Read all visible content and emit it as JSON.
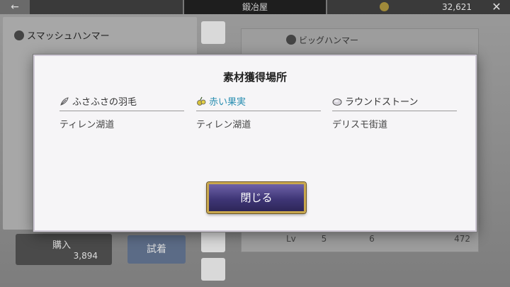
{
  "header": {
    "back_icon": "back-arrow-icon",
    "title": "鍛冶屋",
    "coin_icon": "coin-icon",
    "coins": "32,621",
    "close_icon": "close-icon"
  },
  "background": {
    "left_item_name": "スマッシュハンマー",
    "right_item_name": "ビッグハンマー",
    "lv_label": "Lv",
    "lv_value": "5",
    "stat_value": "6",
    "right_price": "472",
    "buy_label": "購入",
    "buy_price": "3,894",
    "try_label": "試着"
  },
  "modal": {
    "title": "素材獲得場所",
    "materials": [
      {
        "name": "ふさふさの羽毛",
        "location": "ティレン湖道",
        "icon": "feather-icon",
        "highlight": false
      },
      {
        "name": "赤い果実",
        "location": "ティレン湖道",
        "icon": "fruit-icon",
        "highlight": true
      },
      {
        "name": "ラウンドストーン",
        "location": "デリスモ街道",
        "icon": "stone-icon",
        "highlight": false
      }
    ],
    "close_label": "閉じる"
  },
  "colors": {
    "highlight_text": "#2b8fb2",
    "button_fill": "#3f3677",
    "button_border": "#c9a84e"
  }
}
